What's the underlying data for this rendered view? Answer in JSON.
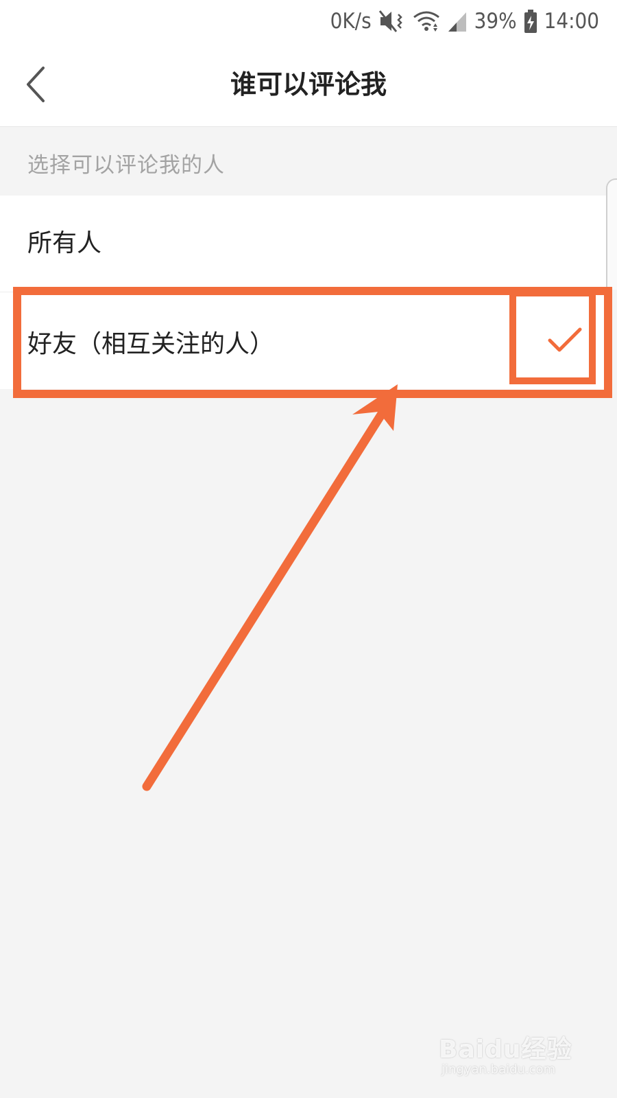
{
  "status_bar": {
    "net_speed": "0K/s",
    "battery_percent": "39%",
    "time": "14:00",
    "icons": [
      "mute-vibrate-icon",
      "wifi-icon",
      "signal-icon",
      "battery-charging-icon"
    ]
  },
  "nav": {
    "title": "谁可以评论我",
    "back_icon": "chevron-left-icon"
  },
  "section": {
    "header": "选择可以评论我的人"
  },
  "options": [
    {
      "label": "所有人",
      "selected": false
    },
    {
      "label": "好友（相互关注的人）",
      "selected": true
    }
  ],
  "colors": {
    "accent": "#f26c3b",
    "background": "#f4f4f4",
    "header_text": "#a3a3a3"
  },
  "watermark": {
    "main": "Baidu经验",
    "sub": "jingyan.baidu.com"
  }
}
